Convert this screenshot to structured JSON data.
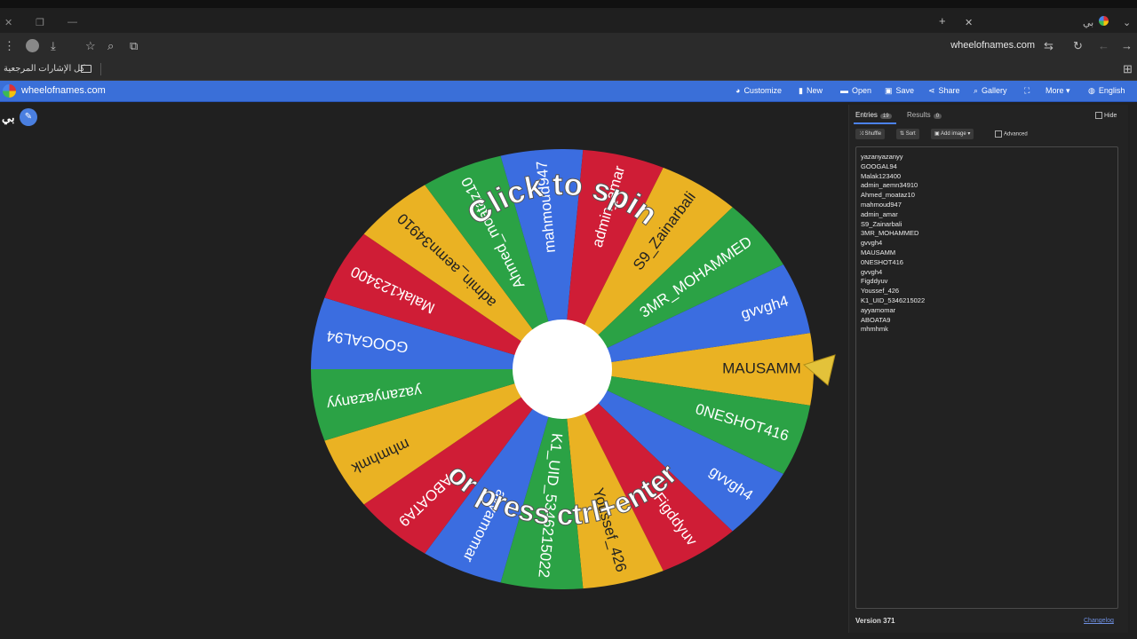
{
  "browser": {
    "tab_title": "بي",
    "url": "wheelofnames.com",
    "bookmarks_label": "كل الإشارات المرجعية"
  },
  "app": {
    "site_name": "wheelofnames.com",
    "menu": [
      {
        "label": "Customize",
        "icon": "palette-icon"
      },
      {
        "label": "New",
        "icon": "file-icon"
      },
      {
        "label": "Open",
        "icon": "folder-icon"
      },
      {
        "label": "Save",
        "icon": "save-icon"
      },
      {
        "label": "Share",
        "icon": "share-icon"
      },
      {
        "label": "Gallery",
        "icon": "search-icon"
      },
      {
        "label": "",
        "icon": "fullscreen-icon"
      },
      {
        "label": "More",
        "icon": "chevron-down-icon"
      },
      {
        "label": "English",
        "icon": "globe-icon"
      }
    ],
    "wheel_title": "بي"
  },
  "wheel": {
    "segments": [
      "MAUSAMM",
      "0NESHOT416",
      "gvvgh4",
      "Figddyuv",
      "Youssef_426",
      "K1_UID_5346215022",
      "ayyamomar",
      "ABOATA9",
      "mhmhmk",
      "yazanyazanyy",
      "GOOGAL94",
      "Malak123400",
      "admin_aemn34910",
      "Ahmed_moataz10",
      "mahmoud947",
      "admin_amar",
      "S9_Zainarbali",
      "3MR_MOHAMMED",
      "gvvgh4"
    ],
    "colors": [
      "#eab223",
      "#2ba245",
      "#3b6de0",
      "#cf1d36"
    ],
    "overlay_top": "Click to spin",
    "overlay_bottom": "or press ctrl+enter"
  },
  "panel": {
    "tabs": [
      {
        "label": "Entries",
        "count": "19"
      },
      {
        "label": "Results",
        "count": "0"
      }
    ],
    "hide_label": "Hide",
    "buttons": {
      "shuffle": "Shuffle",
      "sort": "Sort",
      "add_image": "Add image"
    },
    "advanced_label": "Advanced",
    "entries": [
      "yazanyazanyy",
      "GOOGAL94",
      "Malak123400",
      "admin_aemn34910",
      "Ahmed_moataz10",
      "mahmoud947",
      "admin_amar",
      "S9_Zainarbali",
      "3MR_MOHAMMED",
      "gvvgh4",
      "MAUSAMM",
      "0NESHOT416",
      "gvvgh4",
      "Figddyuv",
      "Youssef_426",
      "K1_UID_5346215022",
      "ayyamomar",
      "ABOATA9",
      "mhmhmk"
    ],
    "version": "Version 371",
    "changelog": "Changelog"
  }
}
